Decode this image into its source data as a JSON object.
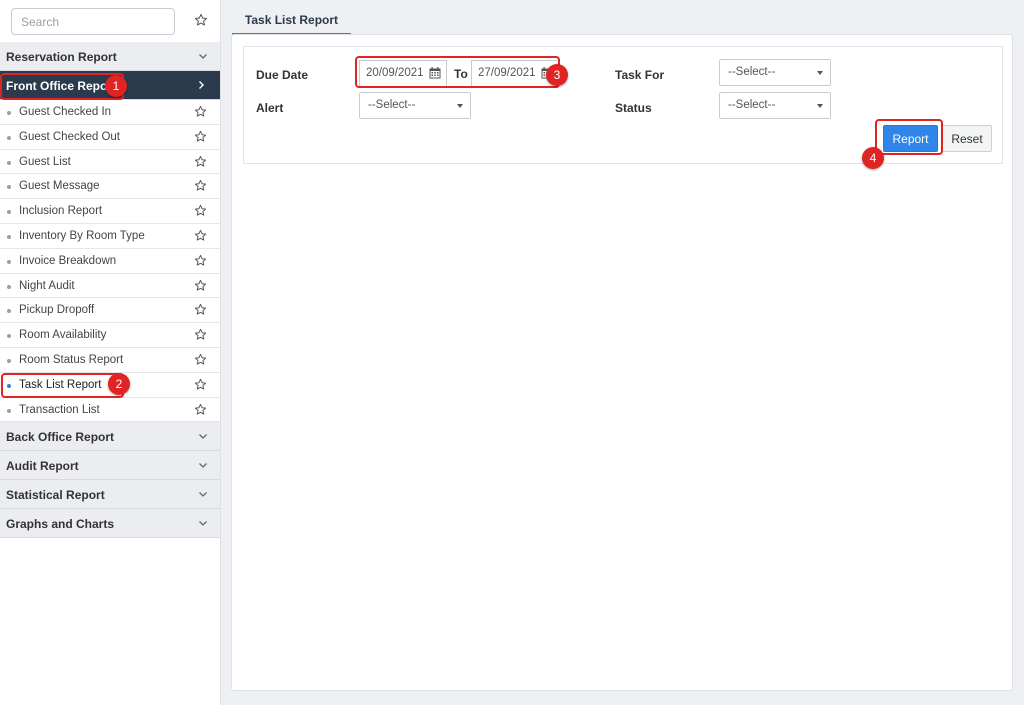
{
  "sidebar": {
    "search_placeholder": "Search",
    "groups": [
      {
        "label": "Reservation Report"
      },
      {
        "label": "Front Office Report"
      },
      {
        "label": "Back Office Report"
      },
      {
        "label": "Audit Report"
      },
      {
        "label": "Statistical Report"
      },
      {
        "label": "Graphs and Charts"
      }
    ],
    "items": [
      {
        "label": "Guest Checked In"
      },
      {
        "label": "Guest Checked Out"
      },
      {
        "label": "Guest List"
      },
      {
        "label": "Guest Message"
      },
      {
        "label": "Inclusion Report"
      },
      {
        "label": "Inventory By Room Type"
      },
      {
        "label": "Invoice Breakdown"
      },
      {
        "label": "Night Audit"
      },
      {
        "label": "Pickup Dropoff"
      },
      {
        "label": "Room Availability"
      },
      {
        "label": "Room Status Report"
      },
      {
        "label": "Task List Report"
      },
      {
        "label": "Transaction List"
      }
    ],
    "selected_item": "Task List Report"
  },
  "main": {
    "tab_label": "Task List Report",
    "form": {
      "due_date_label": "Due Date",
      "date_from": "20/09/2021",
      "to_label": "To",
      "date_to": "27/09/2021",
      "task_for_label": "Task For",
      "task_for_value": "--Select--",
      "alert_label": "Alert",
      "alert_value": "--Select--",
      "status_label": "Status",
      "status_value": "--Select--",
      "report_button": "Report",
      "reset_button": "Reset"
    }
  },
  "annotations": {
    "step1": "1",
    "step2": "2",
    "step3": "3",
    "step4": "4",
    "color": "#e02424"
  },
  "colors": {
    "accent": "#2f86e8",
    "sidebar_active_bg": "#2b3a4d",
    "tab_underline": "#3a7bd5"
  }
}
